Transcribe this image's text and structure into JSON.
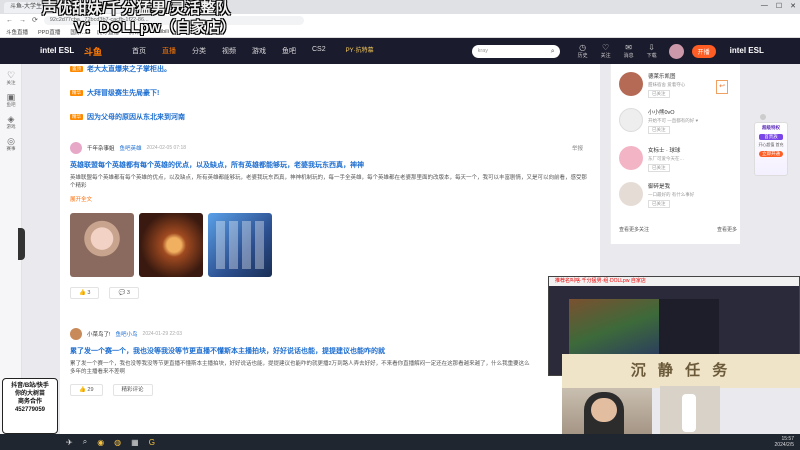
{
  "browser": {
    "tabs": [
      "斗鱼-大学生…",
      "国语版-…",
      "新建…"
    ],
    "url": "92c2d77cba...72bcd3b7-cacfb-1f22-86...",
    "bookmarks": [
      "斗鱼直播",
      "PPD直播",
      "国家…",
      "虎牙直播",
      "腾讯…",
      "bilibili",
      "…"
    ],
    "window_controls": [
      "—",
      "☐",
      "✕"
    ]
  },
  "header": {
    "esl_left": "intel ESL",
    "logo": "斗鱼",
    "nav": [
      "首页",
      "直播",
      "分类",
      "视频",
      "游戏",
      "鱼吧",
      "CS2"
    ],
    "active_nav": "直播",
    "promo": "PY·抗特慕",
    "search_placeholder": "kray",
    "icons": [
      {
        "name": "history-icon",
        "label": "历史"
      },
      {
        "name": "follow-icon",
        "label": "关注"
      },
      {
        "name": "message-icon",
        "label": "消息"
      },
      {
        "name": "download-icon",
        "label": "下载"
      }
    ],
    "live_button": "开播",
    "esl_right": "intel ESL"
  },
  "sidebar": {
    "items": [
      {
        "icon": "heart-icon",
        "label": "关注"
      },
      {
        "icon": "camera-icon",
        "label": "鱼吧"
      },
      {
        "icon": "game-icon",
        "label": "游戏"
      },
      {
        "icon": "sport-icon",
        "label": "赛事"
      }
    ]
  },
  "feed": {
    "top_links": [
      {
        "badge": "置顶",
        "text": "老大太直爆来之子掌柜出。"
      },
      {
        "badge": "精华",
        "text": "大拜冒级赛生先局豪下!"
      },
      {
        "badge": "精华",
        "text": "因为父母的原因从东北来到河南"
      }
    ],
    "posts": [
      {
        "author": "千年杂事姐",
        "group": "鱼吧英雄",
        "time": "2024-02-05 07:18",
        "report": "举报",
        "title": "英雄联盟每个英雄都有每个英雄的优点，以及缺点，所有英雄都能够玩，老婆我玩东西真，神神",
        "body": "英雄联盟每个英雄都有每个英雄的优点，以及缺点，所有英雄都能够玩，老婆我玩东西真，神神机制玩的，每一手全英雄，每个英雄都在老婆那里面的改版本，每天一个，我可以丰富剧情，又是可以向前看，感受那个精彩",
        "expand": "展开全文",
        "likes": "3",
        "comments": "3"
      },
      {
        "author": "小菜鸟了!",
        "group": "鱼吧小鸟",
        "time": "2024-01-29 22:03",
        "title": "累了发一个赛一个，我也没等我没等节更直播不懂斯本主播拍块，好好说话也能，提提建议也能咋的就",
        "body": "累了发一个赛一个，我也没等我没等节更直播不懂斯本主播拍块，好好说话也能，提提建议也能咋的就更播2万到路人弄去好好，不来看你直播解闷一定还在这那看越来越了，什么我重要这么多年的主播看来不差啊",
        "likes": "29",
        "comments": "精彩评论"
      }
    ]
  },
  "right_panel": {
    "users": [
      {
        "name": "德莱乐凯图",
        "desc": "甜妹宿舍 爱着夺心",
        "follow": "已关注"
      },
      {
        "name": "小小熊0vO",
        "desc": "开始不可 一直都有的好 ♥",
        "follow": "已关注"
      },
      {
        "name": "女标士 · 球球",
        "desc": "东厂可爱今天在…",
        "follow": "已关注"
      },
      {
        "name": "御碎是我",
        "desc": "一口最好的 有什么事好",
        "follow": "已关注"
      }
    ],
    "footer_left": "查看更多关注",
    "footer_right": "查看更多",
    "top_button": "↩"
  },
  "ad": {
    "title": "超级特权",
    "tag": "首贵族",
    "sub": "开心超值 首充",
    "button": "立即开通"
  },
  "overlay": {
    "title": "声优甜妹/千分猛男/灵活整队",
    "subtitle": "V：DOLLpw（自家店）",
    "card_lines": [
      "抖音/B站/快手",
      "你的大树苗",
      "商务合作",
      "452779059"
    ],
    "pip_bar": "推荐名叫啥·千分猛男·组·DOLLpw 自家店",
    "banner": "沉 静 任 务"
  },
  "taskbar": {
    "icons": [
      "start-icon",
      "search-icon",
      "taskview-icon",
      "browser-icon",
      "app-icon",
      "game-icon"
    ],
    "time": "15:57",
    "date": "2024/2/5"
  },
  "colors": {
    "accent": "#ff7a00",
    "link": "#1f6fd1",
    "header_bg": "#1b1b2e"
  }
}
